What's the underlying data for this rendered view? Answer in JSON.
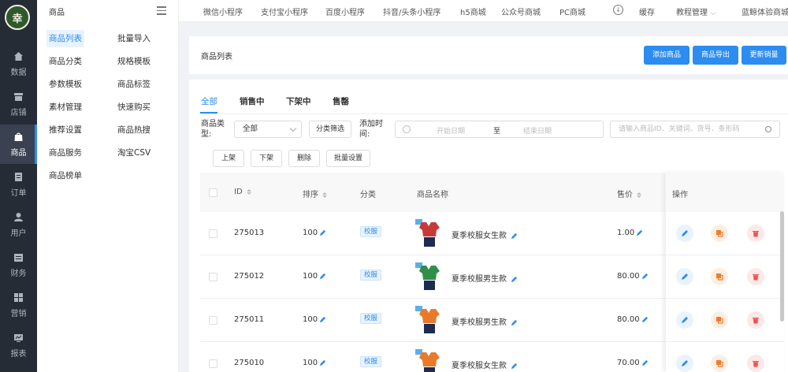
{
  "rail": {
    "logo": "幸",
    "items": [
      {
        "label": "数据",
        "icon": "home-icon"
      },
      {
        "label": "店铺",
        "icon": "store-icon"
      },
      {
        "label": "商品",
        "icon": "bag-icon"
      },
      {
        "label": "订单",
        "icon": "document-icon"
      },
      {
        "label": "用户",
        "icon": "user-icon"
      },
      {
        "label": "财务",
        "icon": "finance-icon"
      },
      {
        "label": "营销",
        "icon": "grid-icon"
      },
      {
        "label": "报表",
        "icon": "chart-icon"
      }
    ]
  },
  "submenu": {
    "title": "商品",
    "col1": [
      "商品列表",
      "商品分类",
      "参数模板",
      "素材管理",
      "推荐设置",
      "商品服务",
      "商品榜单"
    ],
    "col2": [
      "批量导入",
      "规格模板",
      "商品标签",
      "快速购买",
      "商品热搜",
      "淘宝CSV"
    ]
  },
  "topbar": {
    "items": [
      "微信小程序",
      "支付宝小程序",
      "百度小程序",
      "抖音/头条小程序",
      "h5商城",
      "公众号商城",
      "PC商城"
    ],
    "cache": "缓存",
    "tutorial": "教程管理",
    "user": "蓝鲸体验商城"
  },
  "pagehead": {
    "title": "商品列表",
    "add": "添加商品",
    "export": "商品导出",
    "update_stock": "更新销量"
  },
  "tabs": [
    "全部",
    "销售中",
    "下架中",
    "售罄"
  ],
  "filters": {
    "type_label": "商品类型:",
    "type_value": "全部",
    "category_filter": "分类筛选",
    "time_label": "添加时间:",
    "start_placeholder": "开始日期",
    "to": "至",
    "end_placeholder": "结束日期",
    "search_placeholder": "请输入商品ID、关键词、货号、条形码"
  },
  "actions": [
    "上架",
    "下架",
    "删除",
    "批量设置"
  ],
  "table": {
    "headers": {
      "id": "ID",
      "sort": "排序",
      "category": "分类",
      "name": "商品名称",
      "price": "售价",
      "ops": "操作"
    },
    "rows": [
      {
        "id": "275013",
        "sort": "100",
        "category": "校服",
        "name": "夏季校服女生款",
        "price": "1.00"
      },
      {
        "id": "275012",
        "sort": "100",
        "category": "校服",
        "name": "夏季校服男生款",
        "price": "80.00"
      },
      {
        "id": "275011",
        "sort": "100",
        "category": "校服",
        "name": "夏季校服男生款",
        "price": "80.00"
      },
      {
        "id": "275010",
        "sort": "100",
        "category": "校服",
        "name": "夏季校服女生款",
        "price": "70.00"
      }
    ]
  },
  "colors": {
    "accent": "#2d8cf0",
    "rail": "#262c35",
    "edit": "#2d8cf0",
    "copy": "#f07b2d",
    "delete": "#f05252"
  }
}
